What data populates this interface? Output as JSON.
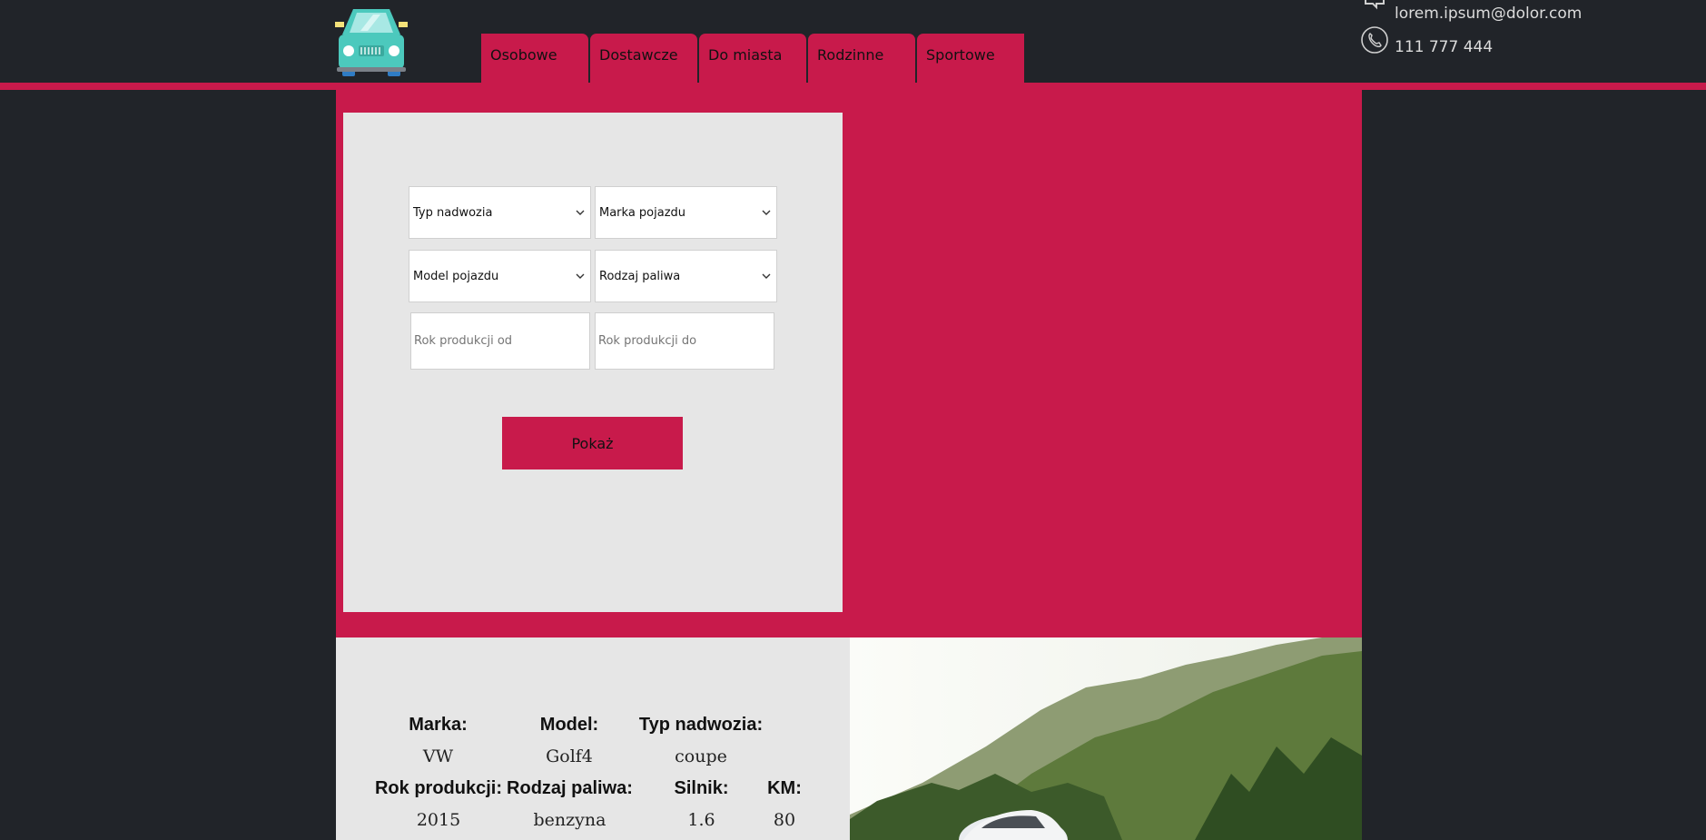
{
  "header": {
    "nav": [
      "Osobowe",
      "Dostawcze",
      "Do miasta",
      "Rodzinne",
      "Sportowe"
    ],
    "email": "lorem.ipsum@dolor.com",
    "phone": "111 777 444"
  },
  "search": {
    "body_type": "Typ nadwozia",
    "brand": "Marka pojazdu",
    "model": "Model pojazdu",
    "fuel": "Rodzaj paliwa",
    "year_from_placeholder": "Rok produkcji od",
    "year_to_placeholder": "Rok produkcji do",
    "submit_label": "Pokaż"
  },
  "car": {
    "labels": {
      "brand": "Marka:",
      "model": "Model:",
      "body": "Typ nadwozia:",
      "year": "Rok produkcji:",
      "fuel": "Rodzaj paliwa:",
      "engine": "Silnik:",
      "hp": "KM:"
    },
    "values": {
      "brand": "VW",
      "model": "Golf4",
      "body": "coupe",
      "year": "2015",
      "fuel": "benzyna",
      "engine": "1.6",
      "hp": "80"
    }
  },
  "colors": {
    "accent": "#c81a4b",
    "background": "#212429",
    "panel": "#e6e6e6"
  }
}
